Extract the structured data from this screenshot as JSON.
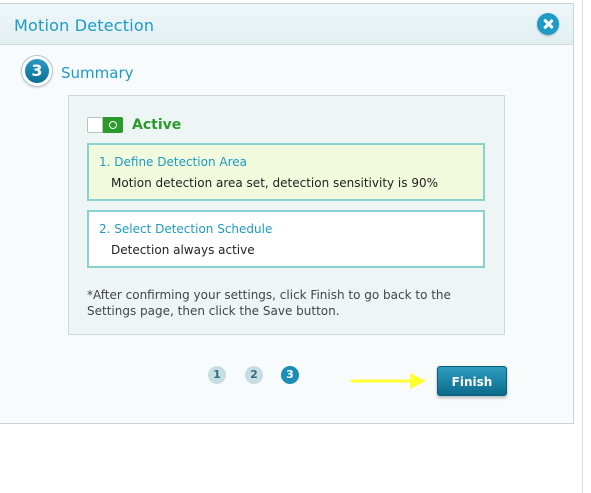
{
  "dialog": {
    "title": "Motion Detection",
    "close_icon": "close-icon"
  },
  "step": {
    "number": "3",
    "title": "Summary"
  },
  "summary": {
    "toggle_state": "on",
    "active_label": "Active",
    "items": [
      {
        "heading": "1. Define Detection Area",
        "detail": "Motion detection area set, detection sensitivity is 90%"
      },
      {
        "heading": "2. Select Detection Schedule",
        "detail": "Detection always active"
      }
    ],
    "note": "*After confirming your settings, click Finish to go back to the Settings page, then click the Save button."
  },
  "pager": {
    "pages": [
      "1",
      "2",
      "3"
    ],
    "current": "3"
  },
  "footer": {
    "finish_label": "Finish"
  },
  "colors": {
    "accent": "#1d9bc4",
    "active_green": "#2a9a2a",
    "annotation_arrow": "#ffff33"
  }
}
